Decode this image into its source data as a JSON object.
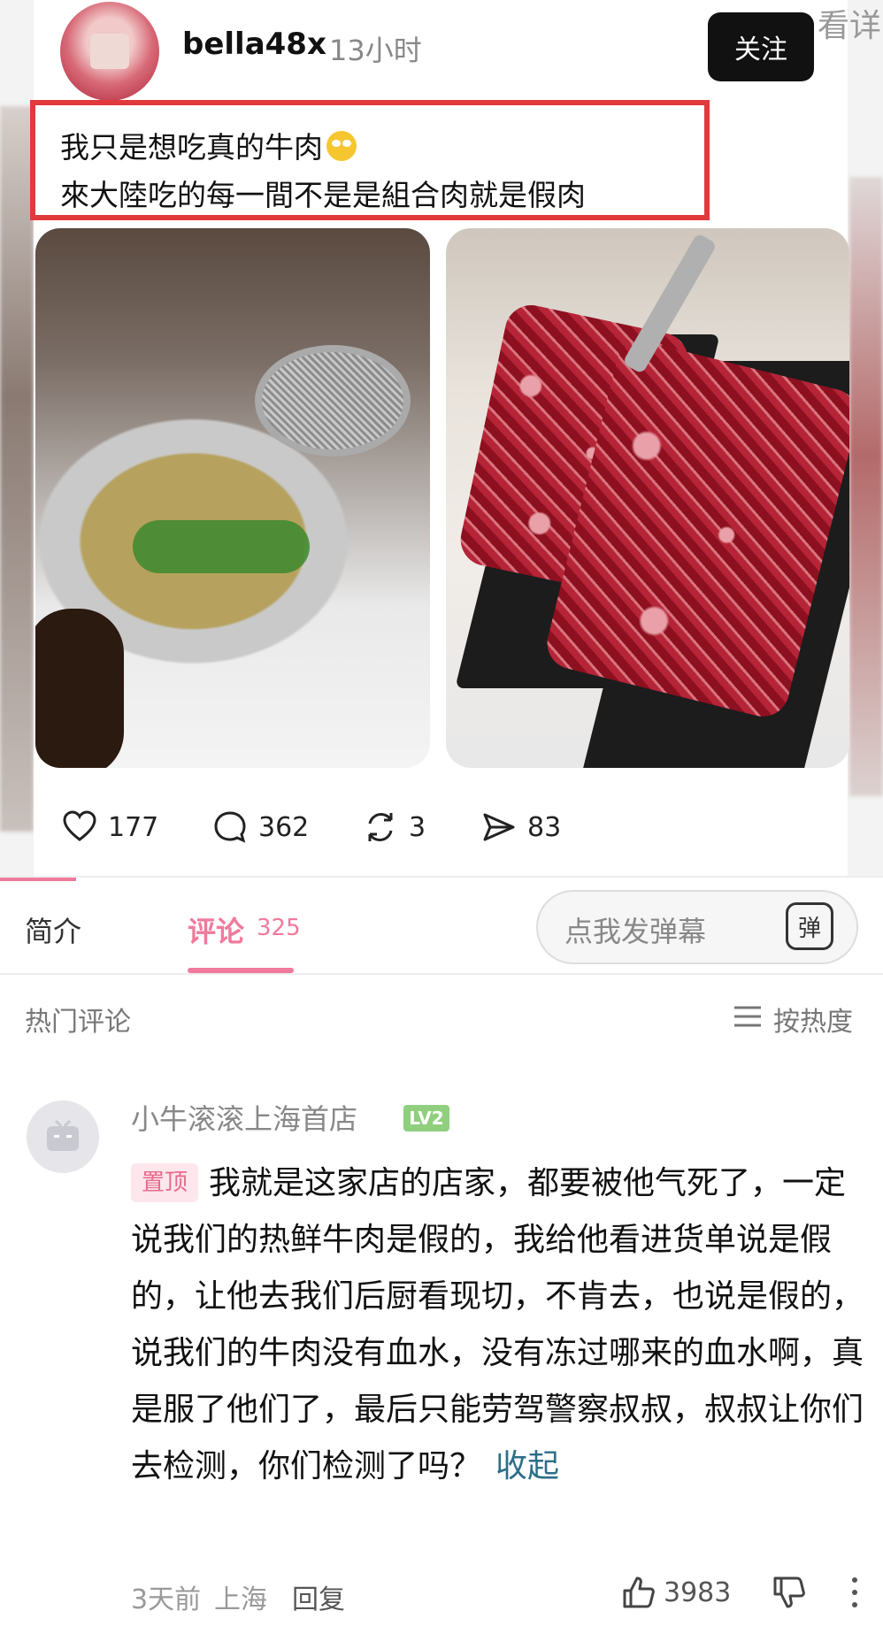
{
  "post": {
    "username": "bella48x",
    "time": "13小时",
    "follow_label": "关注",
    "watermark": "看详",
    "caption_line1": "我只是想吃真的牛肉",
    "caption_line2": "來大陸吃的每一間不是是組合肉就是假肉",
    "stats": {
      "likes": "177",
      "comments": "362",
      "reposts": "3",
      "shares": "83"
    }
  },
  "tabs": {
    "intro": "简介",
    "comments": "评论",
    "comments_count": "325",
    "danmu_placeholder": "点我发弹幕",
    "danmu_icon": "弹"
  },
  "comments_header": {
    "hot": "热门评论",
    "sort": "按热度"
  },
  "comment": {
    "username": "小牛滚滚上海首店",
    "level": "LV2",
    "pin_label": "置顶",
    "text": "我就是这家店的店家，都要被他气死了，一定说我们的热鲜牛肉是假的，我给他看进货单说是假的，让他去我们后厨看现切，不肯去，也说是假的，说我们的牛肉没有血水，没有冻过哪来的血水啊，真是服了他们了，最后只能劳驾警察叔叔，叔叔让你们去检测，你们检测了吗？",
    "collapse": "收起",
    "time": "3天前",
    "location": "上海",
    "reply": "回复",
    "likes": "3983"
  },
  "colors": {
    "accent_pink": "#f07a9c",
    "highlight_red": "#e2393d",
    "collapse_blue": "#2c6e87"
  }
}
